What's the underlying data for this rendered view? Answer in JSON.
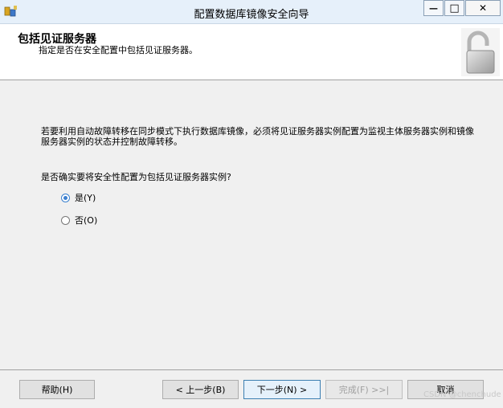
{
  "window": {
    "title": "配置数据库镜像安全向导",
    "minimize_glyph": "—",
    "maximize_glyph": "□",
    "close_glyph": "✕"
  },
  "header": {
    "title": "包括见证服务器",
    "subtitle": "指定是否在安全配置中包括见证服务器。",
    "icon": "padlock-icon"
  },
  "main": {
    "description": "若要利用自动故障转移在同步模式下执行数据库镜像，必须将见证服务器实例配置为监视主体服务器实例和镜像服务器实例的状态并控制故障转移。",
    "question": "是否确实要将安全性配置为包括见证服务器实例?",
    "options": [
      {
        "label": "是(Y)",
        "selected": true
      },
      {
        "label": "否(O)",
        "selected": false
      }
    ]
  },
  "footer": {
    "help": "帮助(H)",
    "back": "< 上一步(B)",
    "next": "下一步(N) >",
    "finish": "完成(F) >>|",
    "cancel": "取消"
  },
  "watermark": "CSDN @chenchude",
  "colors": {
    "accent": "#3b7fd0",
    "titlebar": "#e6f0fa"
  }
}
